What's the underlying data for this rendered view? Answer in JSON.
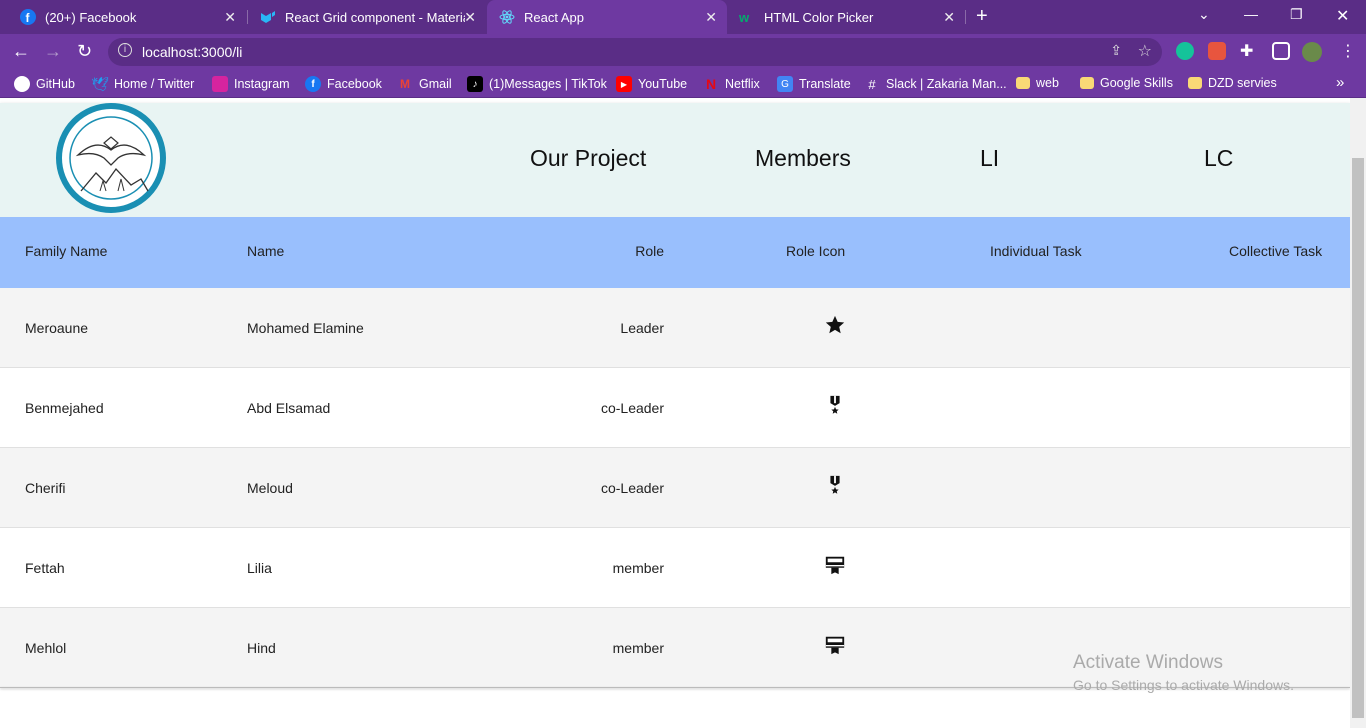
{
  "tabs": [
    {
      "title": "(20+) Facebook",
      "icon": "facebook-icon"
    },
    {
      "title": "React Grid component - Material",
      "icon": "mui-icon"
    },
    {
      "title": "React App",
      "icon": "react-icon"
    },
    {
      "title": "HTML Color Picker",
      "icon": "w3schools-icon"
    }
  ],
  "address": {
    "url": "localhost:3000/li"
  },
  "bookmarks": [
    {
      "label": "GitHub",
      "icon": "github-icon"
    },
    {
      "label": "Home / Twitter",
      "icon": "twitter-icon"
    },
    {
      "label": "Instagram",
      "icon": "instagram-icon"
    },
    {
      "label": "Facebook",
      "icon": "facebook-icon"
    },
    {
      "label": "Gmail",
      "icon": "gmail-icon"
    },
    {
      "label": "(1)Messages | TikTok",
      "icon": "tiktok-icon"
    },
    {
      "label": "YouTube",
      "icon": "youtube-icon"
    },
    {
      "label": "Netflix",
      "icon": "netflix-icon"
    },
    {
      "label": "Translate",
      "icon": "translate-icon"
    },
    {
      "label": "Slack | Zakaria Man...",
      "icon": "slack-icon"
    },
    {
      "label": "web",
      "icon": "folder-icon"
    },
    {
      "label": "Google Skills",
      "icon": "folder-icon"
    },
    {
      "label": "DZD servies",
      "icon": "folder-icon"
    }
  ],
  "nav": {
    "links": [
      "Our Project",
      "Members",
      "LI",
      "LC"
    ]
  },
  "grid": {
    "headers": [
      "Family Name",
      "Name",
      "Role",
      "Role Icon",
      "Individual Task",
      "Collective Task"
    ],
    "rows": [
      {
        "family": "Meroaune",
        "name": "Mohamed Elamine",
        "role": "Leader",
        "icon": "star-icon"
      },
      {
        "family": "Benmejahed",
        "name": "Abd Elsamad",
        "role": "co-Leader",
        "icon": "military-medal-icon"
      },
      {
        "family": "Cherifi",
        "name": "Meloud",
        "role": "co-Leader",
        "icon": "military-medal-icon"
      },
      {
        "family": "Fettah",
        "name": "Lilia",
        "role": "member",
        "icon": "card-membership-icon"
      },
      {
        "family": "Mehlol",
        "name": "Hind",
        "role": "member",
        "icon": "card-membership-icon"
      }
    ]
  },
  "watermark": {
    "title": "Activate Windows",
    "subtitle": "Go to Settings to activate Windows."
  }
}
